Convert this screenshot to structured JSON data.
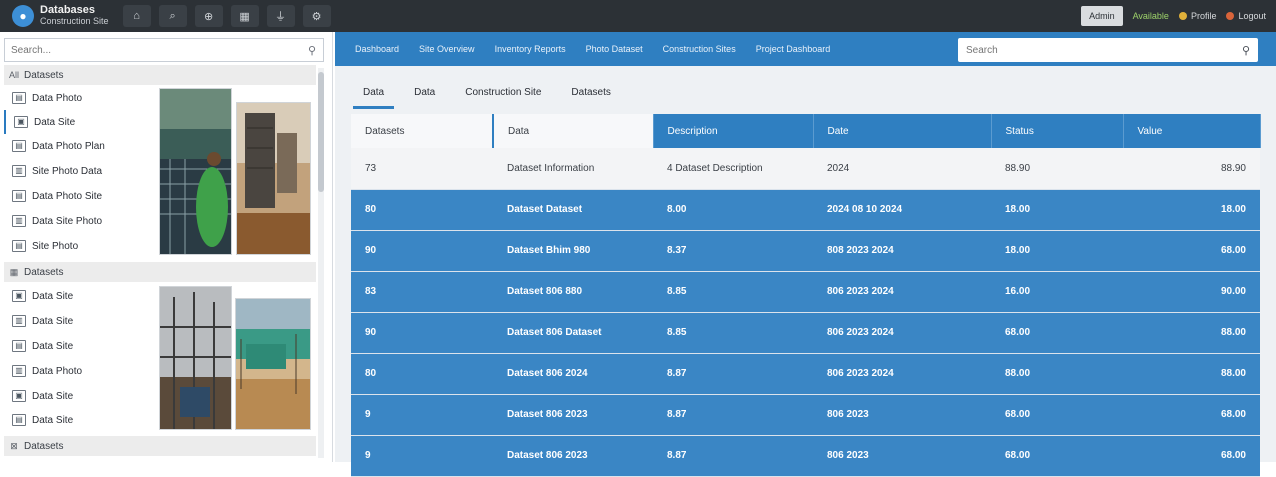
{
  "app": {
    "brand_line1": "Databases",
    "brand_line2": "Construction Site"
  },
  "toolbar": {
    "icons": [
      "home-icon",
      "search-icon",
      "zoom-icon",
      "grid-icon",
      "filter-icon",
      "settings-icon"
    ],
    "glyphs": [
      "⌂",
      "⌕",
      "⊕",
      "▦",
      "⏚",
      "⚙"
    ]
  },
  "topright": {
    "button_label": "Admin",
    "status_label": "Available",
    "link1": "Profile",
    "link2": "Logout"
  },
  "sidebar": {
    "search_placeholder": "Search...",
    "categories": [
      {
        "label": "Datasets",
        "marker": "All"
      },
      {
        "label": "Datasets"
      }
    ],
    "items_group1": [
      "Data Photo",
      "Data Site",
      "Data Photo Plan",
      "Site Photo Data",
      "Data Photo Site",
      "Data Site Photo",
      "Site Photo"
    ],
    "items_group2": [
      "Data Site",
      "Data Site",
      "Data Site",
      "Data Photo",
      "Data Site",
      "Data Site"
    ],
    "footer_label": "Datasets"
  },
  "nav": {
    "items": [
      "Dashboard",
      "Site Overview",
      "Inventory Reports",
      "Photo Dataset",
      "Construction Sites",
      "Project Dashboard"
    ],
    "search_placeholder": "Search"
  },
  "tabs": [
    "Data",
    "Data",
    "Construction Site",
    "Datasets"
  ],
  "table": {
    "headers": [
      "Datasets",
      "Data",
      "Description",
      "Date",
      "Status",
      "Value"
    ],
    "rows": [
      {
        "id": "73",
        "name": "Dataset Information",
        "desc": "4 Dataset Description",
        "date": "2024",
        "status": "88.90",
        "value": "88.90"
      },
      {
        "id": "80",
        "name": "Dataset Dataset",
        "desc": "8.00",
        "date": "2024 08 10 2024",
        "status": "18.00",
        "value": "18.00"
      },
      {
        "id": "90",
        "name": "Dataset Bhim 980",
        "desc": "8.37",
        "date": "808 2023 2024",
        "status": "18.00",
        "value": "68.00"
      },
      {
        "id": "83",
        "name": "Dataset 806 880",
        "desc": "8.85",
        "date": "806 2023 2024",
        "status": "16.00",
        "value": "90.00"
      },
      {
        "id": "90",
        "name": "Dataset 806 Dataset",
        "desc": "8.85",
        "date": "806 2023 2024",
        "status": "68.00",
        "value": "88.00"
      },
      {
        "id": "80",
        "name": "Dataset 806 2024",
        "desc": "8.87",
        "date": "806 2023 2024",
        "status": "88.00",
        "value": "88.00"
      },
      {
        "id": "9",
        "name": "Dataset 806 2023",
        "desc": "8.87",
        "date": "806 2023",
        "status": "68.00",
        "value": "68.00"
      },
      {
        "id": "9",
        "name": "Dataset 806 2023",
        "desc": "8.87",
        "date": "806 2023",
        "status": "68.00",
        "value": "68.00"
      }
    ]
  },
  "colors": {
    "topbar": "#2c3136",
    "accent": "#2f7fc1",
    "row_blue": "#3a86c5"
  }
}
